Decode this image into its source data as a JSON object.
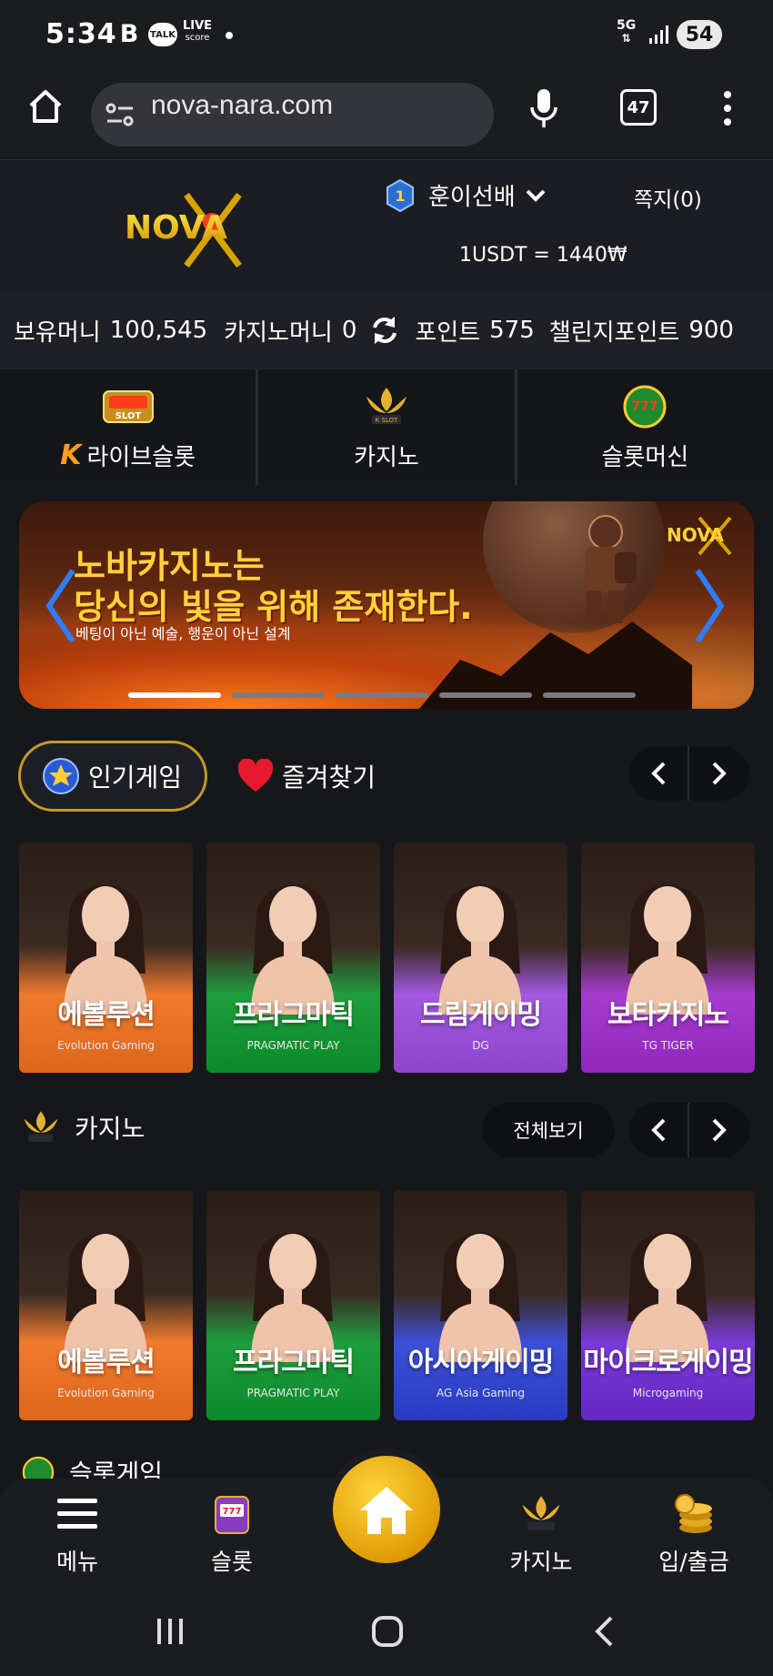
{
  "status_bar": {
    "time": "5:34",
    "notif_b": "B",
    "notif_talk": "TALK",
    "notif_live": "LIVE",
    "notif_score": "score",
    "network": "5G",
    "battery": "54"
  },
  "browser": {
    "url": "nova-nara.com",
    "tab_count": "47"
  },
  "header": {
    "logo_text": "NOVA",
    "level": "1",
    "username": "훈이선배",
    "messages": "쪽지(0)",
    "rate": "1USDT = 1440₩"
  },
  "balance": {
    "money_label": "보유머니",
    "money_value": "100,545",
    "casino_money_label": "카지노머니",
    "casino_money_value": "0",
    "points_label": "포인트",
    "points_value": "575",
    "challenge_label": "챌린지포인트",
    "challenge_value": "900"
  },
  "categories": [
    {
      "label": "라이브슬롯",
      "icon": "live-slot-icon",
      "prefix": "K"
    },
    {
      "label": "카지노",
      "icon": "k-slot-casino-icon"
    },
    {
      "label": "슬롯머신",
      "icon": "777-slots-icon"
    }
  ],
  "banner": {
    "title_line1": "노바카지노는",
    "title_line2": "당신의 빛을 위해 존재한다.",
    "subtitle": "베팅이 아닌 예술, 행운이 아닌 설계",
    "logo": "NOVA",
    "slide_count": 5,
    "active_slide": 0
  },
  "popular_section": {
    "tab_popular": "인기게임",
    "tab_favorites": "즐겨찾기",
    "games": [
      {
        "name": "에볼루션",
        "provider": "Evolution Gaming",
        "bg": "#f07a2e"
      },
      {
        "name": "프라그마틱",
        "provider": "PRAGMATIC PLAY",
        "bg": "#1f9e3e"
      },
      {
        "name": "드림게이밍",
        "provider": "DG",
        "bg": "#a258e0"
      },
      {
        "name": "보타카지노",
        "provider": "TG TIGER",
        "bg": "#a63bd0"
      }
    ]
  },
  "casino_section": {
    "title": "카지노",
    "view_all": "전체보기",
    "games": [
      {
        "name": "에볼루션",
        "provider": "Evolution Gaming",
        "bg": "#f07a2e"
      },
      {
        "name": "프라그마틱",
        "provider": "PRAGMATIC PLAY",
        "bg": "#1f9e3e"
      },
      {
        "name": "아시아게이밍",
        "provider": "AG Asia Gaming",
        "bg": "#3d4fd6"
      },
      {
        "name": "마이크로게이밍",
        "provider": "Microgaming",
        "bg": "#7a3ad6"
      }
    ]
  },
  "slot_section": {
    "title": "슬롯게임"
  },
  "bottom_nav": {
    "menu": "메뉴",
    "slot": "슬롯",
    "casino": "카지노",
    "deposit": "입/출금"
  }
}
